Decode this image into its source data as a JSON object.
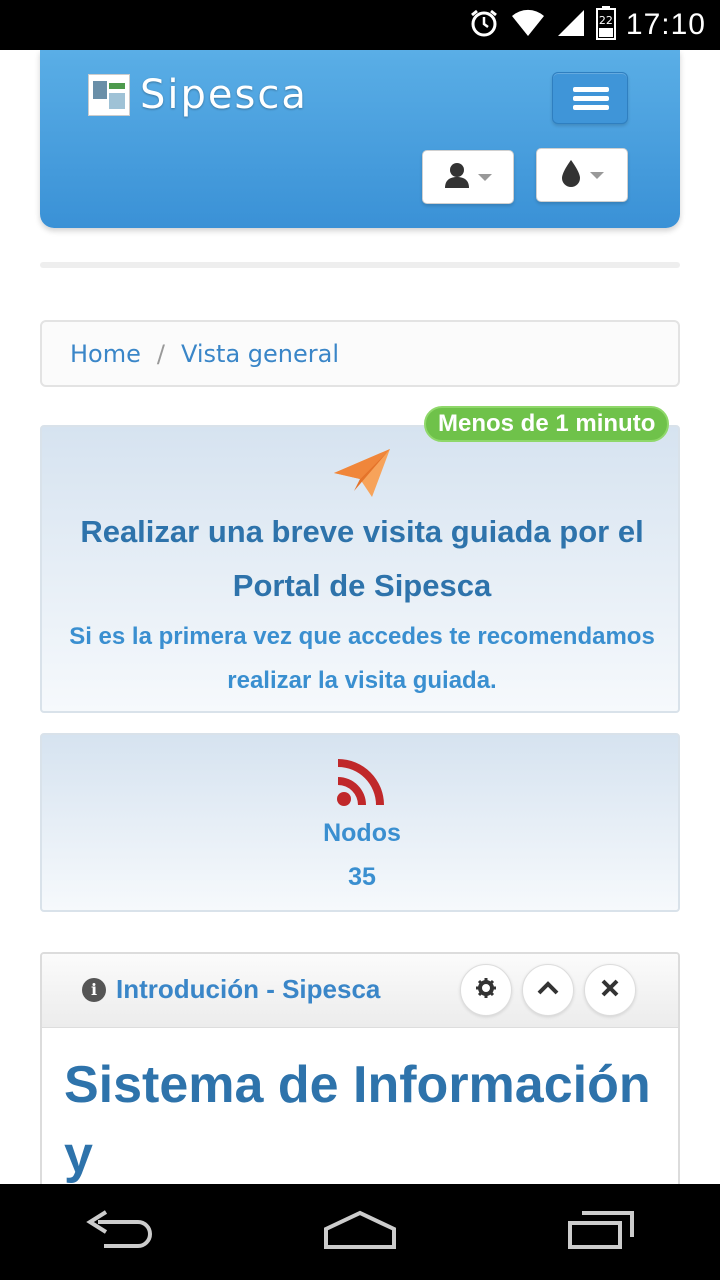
{
  "status_bar": {
    "clock": "17:10",
    "battery_level": "22"
  },
  "navbar": {
    "brand": "Sipesca",
    "menu_icon": "hamburger-icon",
    "user_icon": "user-icon",
    "theme_icon": "drop-icon"
  },
  "breadcrumb": {
    "items": [
      "Home",
      "Vista general"
    ],
    "separator": "/"
  },
  "tour": {
    "badge": "Menos de 1 minuto",
    "icon": "paper-plane-icon",
    "title": "Realizar una breve visita guiada por el Portal de Sipesca",
    "subtitle": "Si es la primera vez que accedes te recomendamos realizar la visita guiada."
  },
  "nodos": {
    "icon": "rss-icon",
    "label": "Nodos",
    "count": "35"
  },
  "widget": {
    "title": "Introdución - Sipesca",
    "heading": "Sistema de Información y"
  },
  "colors": {
    "navbar": "#3a91d6",
    "link": "#3a86c8",
    "badge": "#6fc24a",
    "plane": "#f0863a",
    "rss": "#c0282a"
  }
}
